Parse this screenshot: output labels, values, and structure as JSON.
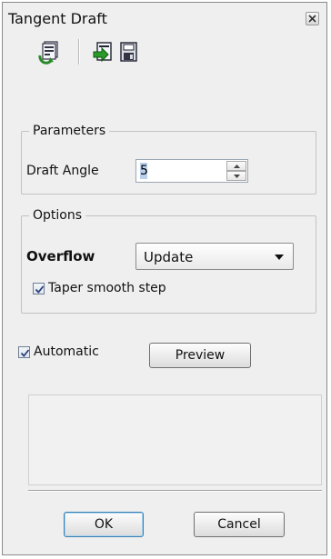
{
  "dialog": {
    "title": "Tangent Draft"
  },
  "toolbar": {
    "icons": [
      "sheet-update-icon",
      "apply-icon",
      "save-icon"
    ]
  },
  "parameters": {
    "group_label": "Parameters",
    "draft_angle_label": "Draft Angle",
    "draft_angle_value": "5"
  },
  "options": {
    "group_label": "Options",
    "overflow_label": "Overflow",
    "overflow_selected": "Update",
    "taper_smooth_step_label": "Taper smooth step",
    "taper_smooth_step_checked": true
  },
  "automatic": {
    "label": "Automatic",
    "checked": true
  },
  "buttons": {
    "preview": "Preview",
    "ok": "OK",
    "cancel": "Cancel"
  },
  "colors": {
    "panel_bg": "#efefef",
    "accent": "#2a8a2a",
    "default_button_border": "#3c7fb1"
  }
}
